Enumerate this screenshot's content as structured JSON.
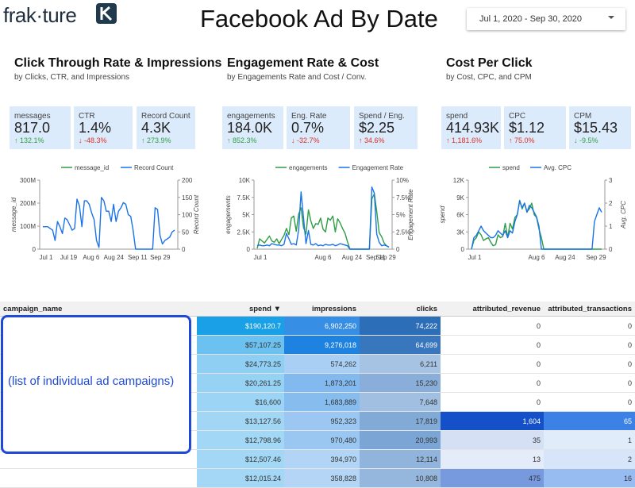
{
  "header": {
    "logo_text": "frak·ture",
    "title": "Facebook Ad By Date",
    "date_range": "Jul 1, 2020 - Sep 30, 2020"
  },
  "colors": {
    "card_bg": "#dcebfb",
    "green": "#2e9e44",
    "blue": "#1a73e8",
    "up": "#2e9e44",
    "down": "#d93025"
  },
  "sections": [
    {
      "title": "Click Through Rate & Impressions",
      "subtitle": "by Clicks, CTR, and Impressions",
      "cards": [
        {
          "label": "messages",
          "value": "817.0",
          "delta": "↑ 132.1%",
          "dir": "up"
        },
        {
          "label": "CTR",
          "value": "1.4%",
          "delta": "↓ -48.3%",
          "dir": "down"
        },
        {
          "label": "Record Count",
          "value": "4.3K",
          "delta": "↑ 273.9%",
          "dir": "up"
        }
      ]
    },
    {
      "title": "Engagement Rate & Cost",
      "subtitle": "by Engagements Rate and Cost / Conv.",
      "cards": [
        {
          "label": "engagements",
          "value": "184.0K",
          "delta": "↑ 852.3%",
          "dir": "up"
        },
        {
          "label": "Eng. Rate",
          "value": "0.7%",
          "delta": "↓ -32.7%",
          "dir": "down"
        },
        {
          "label": "Spend / Eng.",
          "value": "$2.25",
          "delta": "↑ 34.6%",
          "dir": "down"
        }
      ]
    },
    {
      "title": "Cost Per Click",
      "subtitle": "by Cost, CPC, and CPM",
      "cards": [
        {
          "label": "spend",
          "value": "414.93K",
          "delta": "↑ 1,181.6%",
          "dir": "down"
        },
        {
          "label": "CPC",
          "value": "$1.12",
          "delta": "↑ 75.0%",
          "dir": "down"
        },
        {
          "label": "CPM",
          "value": "$15.43",
          "delta": "↓ -9.5%",
          "dir": "up"
        }
      ]
    }
  ],
  "chart_data": [
    {
      "type": "line",
      "x_ticks": [
        "Jul 1",
        "Jul 19",
        "Aug 6",
        "Aug 24",
        "Sep 11",
        "Sep 29"
      ],
      "xlabel": "",
      "legend": [
        "message_id",
        "Record Count"
      ],
      "left_axis": {
        "label": "message_id",
        "ticks": [
          "0",
          "100M",
          "200M",
          "300M"
        ],
        "range": [
          0,
          300
        ]
      },
      "right_axis": {
        "label": "Record Count",
        "ticks": [
          "0",
          "50",
          "100",
          "150",
          "200"
        ],
        "range": [
          0,
          200
        ]
      },
      "series": [
        {
          "name": "Record Count",
          "color": "#1a73e8",
          "axis": "right",
          "values": [
            65,
            65,
            65,
            60,
            55,
            25,
            80,
            65,
            45,
            90,
            85,
            70,
            55,
            60,
            145,
            125,
            65,
            140,
            140,
            130,
            105,
            85,
            25,
            5,
            150,
            140,
            110,
            110,
            80,
            130,
            80,
            110,
            120,
            135,
            130,
            100,
            95,
            55,
            0,
            0,
            0,
            0,
            0,
            0,
            0,
            0,
            120,
            115,
            40,
            15,
            25,
            30,
            35,
            50,
            55
          ]
        }
      ]
    },
    {
      "type": "line",
      "x_ticks": [
        "Jul 1",
        "Aug 6",
        "Aug 24",
        "Sep 11",
        "Sep 29"
      ],
      "legend": [
        "engagements",
        "Engagement Rate"
      ],
      "left_axis": {
        "label": "engagements",
        "ticks": [
          "0",
          "2.5K",
          "5K",
          "7.5K",
          "10K"
        ],
        "range": [
          0,
          10
        ]
      },
      "right_axis": {
        "label": "Engagement Rate",
        "ticks": [
          "0",
          "2.5%",
          "5%",
          "7.5%",
          "10%"
        ],
        "range": [
          0,
          10
        ]
      },
      "series": [
        {
          "name": "engagements",
          "color": "#2e9e44",
          "axis": "left",
          "values": [
            0.1,
            1.5,
            1.2,
            0.9,
            1.4,
            1.9,
            1.2,
            1.0,
            1.5,
            0.8,
            1.4,
            2.0,
            3.0,
            2.1,
            4.5,
            4.8,
            2.6,
            5.1,
            6.0,
            3.1,
            2.2,
            5.7,
            4.1,
            3.0,
            3.7,
            3.6,
            4.5,
            2.9,
            2.5,
            4.5,
            4.2,
            4.8,
            2.5,
            4.4,
            3.8,
            3.0,
            2.3,
            1.1,
            0,
            0,
            0,
            0,
            0,
            0,
            0,
            0,
            0,
            7.3,
            8.0,
            5.5,
            2.4,
            1.8,
            0.9,
            0.5,
            0.3
          ]
        },
        {
          "name": "Engagement Rate",
          "color": "#1a73e8",
          "axis": "right",
          "values": [
            0.5,
            0.6,
            0.5,
            0.5,
            0.6,
            0.5,
            0.8,
            0.7,
            0.6,
            0.6,
            0.5,
            0.7,
            2.3,
            1.5,
            0.7,
            0.8,
            0.6,
            2.8,
            8.3,
            4.5,
            0.8,
            2.7,
            0.7,
            0.6,
            0.8,
            0.5,
            0.6,
            0.5,
            0.7,
            0.6,
            0.6,
            0.7,
            0.5,
            0.6,
            0.8,
            0.7,
            0.6,
            0.5,
            0,
            0,
            0,
            0,
            0,
            0,
            0,
            0,
            0,
            9.0,
            8.1,
            2.2,
            1.0,
            0.5,
            0.6,
            0.5,
            0.3
          ]
        }
      ]
    },
    {
      "type": "line",
      "x_ticks": [
        "Jul 1",
        "Aug 6",
        "Aug 24",
        "Sep 29"
      ],
      "legend": [
        "spend",
        "Avg. CPC"
      ],
      "left_axis": {
        "label": "spend",
        "ticks": [
          "0",
          "3K",
          "6K",
          "9K",
          "12K"
        ],
        "range": [
          0,
          12
        ]
      },
      "right_axis": {
        "label": "Avg. CPC",
        "ticks": [
          "0",
          "1",
          "2",
          "3"
        ],
        "range": [
          0,
          3
        ]
      },
      "series": [
        {
          "name": "spend",
          "color": "#2e9e44",
          "axis": "left",
          "values": [
            0,
            1.5,
            2.0,
            3.0,
            2.5,
            1.5,
            1.8,
            2.0,
            1.2,
            0.6,
            0.8,
            2.5,
            2.0,
            2.2,
            4.5,
            2.0,
            4.5,
            3.5,
            5.5,
            6.0,
            8.5,
            7.0,
            8.0,
            6.5,
            7.0,
            8.0,
            6.0,
            5.5,
            3.5,
            2.0,
            0,
            0,
            0,
            0,
            0,
            0,
            0,
            0,
            0,
            0,
            0,
            0,
            0,
            0,
            0,
            0,
            0,
            0,
            0,
            0,
            0,
            0,
            0,
            0,
            0
          ]
        },
        {
          "name": "Avg. CPC",
          "color": "#1a73e8",
          "axis": "right",
          "values": [
            0,
            0.5,
            0.6,
            0.8,
            1.0,
            0.8,
            0.7,
            0.6,
            0.5,
            0.5,
            0.6,
            0.8,
            0.7,
            0.6,
            0.8,
            0.5,
            0.8,
            0.7,
            1.2,
            1.5,
            2.1,
            1.8,
            2.0,
            1.6,
            1.9,
            1.8,
            1.6,
            1.4,
            1.0,
            0,
            0,
            0,
            0,
            0,
            0,
            0,
            0,
            0,
            0,
            0,
            0,
            0,
            0,
            0,
            0,
            0,
            0,
            0,
            0,
            0,
            0,
            1.2,
            1.5,
            1.8,
            1.6
          ]
        }
      ]
    }
  ],
  "table": {
    "columns": [
      "campaign_name",
      "spend ▼",
      "impressions",
      "clicks",
      "attributed_revenue",
      "attributed_transactions"
    ],
    "rows": [
      [
        "",
        "$190,120.7",
        "6,902,250",
        "74,222",
        "0",
        "0"
      ],
      [
        "",
        "$57,107.25",
        "9,276,018",
        "64,699",
        "0",
        "0"
      ],
      [
        "",
        "$24,773.25",
        "574,262",
        "6,211",
        "0",
        "0"
      ],
      [
        "",
        "$20,261.25",
        "1,873,201",
        "15,230",
        "0",
        "0"
      ],
      [
        "",
        "$16,600",
        "1,683,889",
        "7,648",
        "0",
        "0"
      ],
      [
        "",
        "$13,127.56",
        "952,323",
        "17,819",
        "1,604",
        "65"
      ],
      [
        "",
        "$12,798.96",
        "970,480",
        "20,993",
        "35",
        "1"
      ],
      [
        "",
        "$12,507.46",
        "394,970",
        "12,114",
        "13",
        "2"
      ],
      [
        "",
        "$12,015.24",
        "358,828",
        "10,808",
        "475",
        "16"
      ]
    ]
  },
  "overlay_note": "(list of individual ad campaigns)"
}
